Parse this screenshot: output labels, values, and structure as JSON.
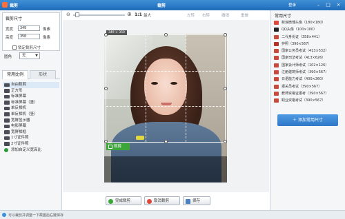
{
  "window": {
    "app_title": "裁剪",
    "center_title": "裁剪",
    "login": "登录",
    "minimize": "–",
    "maximize": "□",
    "close": "×"
  },
  "crop_size": {
    "title": "裁剪尺寸",
    "width_label": "宽度",
    "width_value": "349",
    "height_label": "高度",
    "height_value": "350",
    "unit": "像素",
    "lock_label": "锁定裁剪尺寸"
  },
  "rotate": {
    "label": "圆角",
    "value": "无"
  },
  "tabs": [
    "常用比例",
    "形状"
  ],
  "ratios": [
    "自由裁剪",
    "正方形",
    "标准屏幕",
    "标准屏幕（竖）",
    "单反相机",
    "单反相机（竖）",
    "宽屏显示器",
    "电影屏幕",
    "宽屏相框",
    "1寸证件照",
    "2寸证件照",
    "添加自定义宽高比"
  ],
  "toolbar": {
    "ratio_11": "1:1",
    "fit": "最大",
    "rotate_left": "左转",
    "rotate_right": "右转",
    "undo": "撤销",
    "redo": "重做"
  },
  "crop_box": {
    "size_tag": "349 × 350",
    "button": "裁剪"
  },
  "actions": {
    "done": "完成裁剪",
    "cancel": "取消裁剪",
    "save": "保存"
  },
  "common_sizes": {
    "title": "常用尺寸",
    "items": [
      "新浪微博头像（180×180）",
      "QQ头像（100×100）",
      "二代身份证（358×441）",
      "护照（390×567）",
      "国家公务员考试（413×532）",
      "国家司法考试（413×626）",
      "国家会计师考试（102×126）",
      "注册建筑师考试（390×567）",
      "日语能力考试（400×360）",
      "报关员考试（390×567）",
      "教师资格证报考（390×567）",
      "职业资格考试（390×567）"
    ],
    "icon_colors": [
      "#e0473b",
      "#222222",
      "#c84a3c",
      "#b3322a",
      "#c84a3c",
      "#c84a3c",
      "#c84a3c",
      "#c84a3c",
      "#c84a3c",
      "#c84a3c",
      "#c84a3c",
      "#c84a3c"
    ],
    "add_button": "添加常用尺寸"
  },
  "status": {
    "text": "可以裁剪并调整一下截图后右键保存"
  }
}
